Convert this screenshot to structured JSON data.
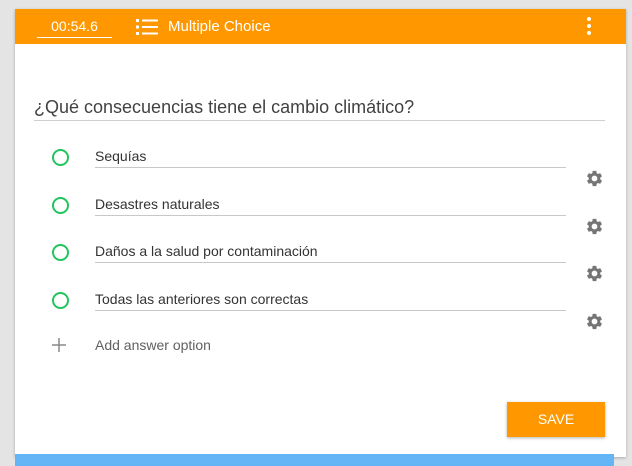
{
  "header": {
    "timer": "00:54.6",
    "list_icon": "list-icon",
    "question_type": "Multiple Choice",
    "menu_icon": "more-vertical-icon"
  },
  "question": {
    "text": "¿Qué consecuencias tiene el cambio climático?"
  },
  "options": [
    {
      "label": "Sequías",
      "settings_icon": "gear-icon"
    },
    {
      "label": "Desastres naturales",
      "settings_icon": "gear-icon"
    },
    {
      "label": "Daños a la salud por contaminación",
      "settings_icon": "gear-icon"
    },
    {
      "label": "Todas las anteriores son correctas",
      "settings_icon": "gear-icon"
    }
  ],
  "add_option": {
    "icon": "plus-icon",
    "label": "Add answer option"
  },
  "actions": {
    "save_label": "SAVE"
  },
  "colors": {
    "accent": "#ff9800",
    "radio": "#22c55e",
    "bottom_bar": "#64b5f6"
  }
}
